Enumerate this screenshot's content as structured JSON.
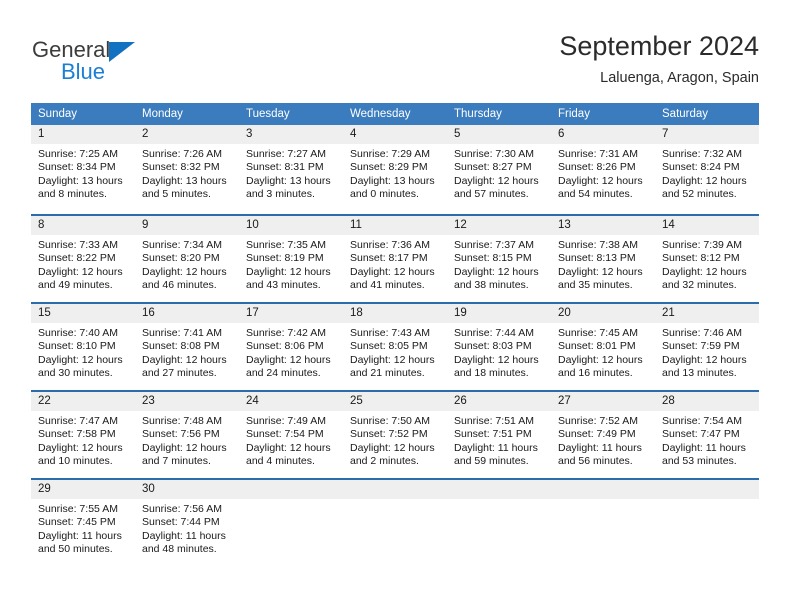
{
  "brand": {
    "name_part1": "General",
    "name_part2": "Blue",
    "accent_color": "#1b7fd4"
  },
  "header": {
    "title": "September 2024",
    "location": "Laluenga, Aragon, Spain"
  },
  "colors": {
    "header_band": "#3a7cbe",
    "row_divider": "#2b6cad",
    "day_number_band": "#efefef"
  },
  "weekdays": [
    "Sunday",
    "Monday",
    "Tuesday",
    "Wednesday",
    "Thursday",
    "Friday",
    "Saturday"
  ],
  "weeks": [
    [
      {
        "day": "1",
        "sunrise": "Sunrise: 7:25 AM",
        "sunset": "Sunset: 8:34 PM",
        "daylight": "Daylight: 13 hours and 8 minutes."
      },
      {
        "day": "2",
        "sunrise": "Sunrise: 7:26 AM",
        "sunset": "Sunset: 8:32 PM",
        "daylight": "Daylight: 13 hours and 5 minutes."
      },
      {
        "day": "3",
        "sunrise": "Sunrise: 7:27 AM",
        "sunset": "Sunset: 8:31 PM",
        "daylight": "Daylight: 13 hours and 3 minutes."
      },
      {
        "day": "4",
        "sunrise": "Sunrise: 7:29 AM",
        "sunset": "Sunset: 8:29 PM",
        "daylight": "Daylight: 13 hours and 0 minutes."
      },
      {
        "day": "5",
        "sunrise": "Sunrise: 7:30 AM",
        "sunset": "Sunset: 8:27 PM",
        "daylight": "Daylight: 12 hours and 57 minutes."
      },
      {
        "day": "6",
        "sunrise": "Sunrise: 7:31 AM",
        "sunset": "Sunset: 8:26 PM",
        "daylight": "Daylight: 12 hours and 54 minutes."
      },
      {
        "day": "7",
        "sunrise": "Sunrise: 7:32 AM",
        "sunset": "Sunset: 8:24 PM",
        "daylight": "Daylight: 12 hours and 52 minutes."
      }
    ],
    [
      {
        "day": "8",
        "sunrise": "Sunrise: 7:33 AM",
        "sunset": "Sunset: 8:22 PM",
        "daylight": "Daylight: 12 hours and 49 minutes."
      },
      {
        "day": "9",
        "sunrise": "Sunrise: 7:34 AM",
        "sunset": "Sunset: 8:20 PM",
        "daylight": "Daylight: 12 hours and 46 minutes."
      },
      {
        "day": "10",
        "sunrise": "Sunrise: 7:35 AM",
        "sunset": "Sunset: 8:19 PM",
        "daylight": "Daylight: 12 hours and 43 minutes."
      },
      {
        "day": "11",
        "sunrise": "Sunrise: 7:36 AM",
        "sunset": "Sunset: 8:17 PM",
        "daylight": "Daylight: 12 hours and 41 minutes."
      },
      {
        "day": "12",
        "sunrise": "Sunrise: 7:37 AM",
        "sunset": "Sunset: 8:15 PM",
        "daylight": "Daylight: 12 hours and 38 minutes."
      },
      {
        "day": "13",
        "sunrise": "Sunrise: 7:38 AM",
        "sunset": "Sunset: 8:13 PM",
        "daylight": "Daylight: 12 hours and 35 minutes."
      },
      {
        "day": "14",
        "sunrise": "Sunrise: 7:39 AM",
        "sunset": "Sunset: 8:12 PM",
        "daylight": "Daylight: 12 hours and 32 minutes."
      }
    ],
    [
      {
        "day": "15",
        "sunrise": "Sunrise: 7:40 AM",
        "sunset": "Sunset: 8:10 PM",
        "daylight": "Daylight: 12 hours and 30 minutes."
      },
      {
        "day": "16",
        "sunrise": "Sunrise: 7:41 AM",
        "sunset": "Sunset: 8:08 PM",
        "daylight": "Daylight: 12 hours and 27 minutes."
      },
      {
        "day": "17",
        "sunrise": "Sunrise: 7:42 AM",
        "sunset": "Sunset: 8:06 PM",
        "daylight": "Daylight: 12 hours and 24 minutes."
      },
      {
        "day": "18",
        "sunrise": "Sunrise: 7:43 AM",
        "sunset": "Sunset: 8:05 PM",
        "daylight": "Daylight: 12 hours and 21 minutes."
      },
      {
        "day": "19",
        "sunrise": "Sunrise: 7:44 AM",
        "sunset": "Sunset: 8:03 PM",
        "daylight": "Daylight: 12 hours and 18 minutes."
      },
      {
        "day": "20",
        "sunrise": "Sunrise: 7:45 AM",
        "sunset": "Sunset: 8:01 PM",
        "daylight": "Daylight: 12 hours and 16 minutes."
      },
      {
        "day": "21",
        "sunrise": "Sunrise: 7:46 AM",
        "sunset": "Sunset: 7:59 PM",
        "daylight": "Daylight: 12 hours and 13 minutes."
      }
    ],
    [
      {
        "day": "22",
        "sunrise": "Sunrise: 7:47 AM",
        "sunset": "Sunset: 7:58 PM",
        "daylight": "Daylight: 12 hours and 10 minutes."
      },
      {
        "day": "23",
        "sunrise": "Sunrise: 7:48 AM",
        "sunset": "Sunset: 7:56 PM",
        "daylight": "Daylight: 12 hours and 7 minutes."
      },
      {
        "day": "24",
        "sunrise": "Sunrise: 7:49 AM",
        "sunset": "Sunset: 7:54 PM",
        "daylight": "Daylight: 12 hours and 4 minutes."
      },
      {
        "day": "25",
        "sunrise": "Sunrise: 7:50 AM",
        "sunset": "Sunset: 7:52 PM",
        "daylight": "Daylight: 12 hours and 2 minutes."
      },
      {
        "day": "26",
        "sunrise": "Sunrise: 7:51 AM",
        "sunset": "Sunset: 7:51 PM",
        "daylight": "Daylight: 11 hours and 59 minutes."
      },
      {
        "day": "27",
        "sunrise": "Sunrise: 7:52 AM",
        "sunset": "Sunset: 7:49 PM",
        "daylight": "Daylight: 11 hours and 56 minutes."
      },
      {
        "day": "28",
        "sunrise": "Sunrise: 7:54 AM",
        "sunset": "Sunset: 7:47 PM",
        "daylight": "Daylight: 11 hours and 53 minutes."
      }
    ],
    [
      {
        "day": "29",
        "sunrise": "Sunrise: 7:55 AM",
        "sunset": "Sunset: 7:45 PM",
        "daylight": "Daylight: 11 hours and 50 minutes."
      },
      {
        "day": "30",
        "sunrise": "Sunrise: 7:56 AM",
        "sunset": "Sunset: 7:44 PM",
        "daylight": "Daylight: 11 hours and 48 minutes."
      },
      {
        "day": "",
        "sunrise": "",
        "sunset": "",
        "daylight": ""
      },
      {
        "day": "",
        "sunrise": "",
        "sunset": "",
        "daylight": ""
      },
      {
        "day": "",
        "sunrise": "",
        "sunset": "",
        "daylight": ""
      },
      {
        "day": "",
        "sunrise": "",
        "sunset": "",
        "daylight": ""
      },
      {
        "day": "",
        "sunrise": "",
        "sunset": "",
        "daylight": ""
      }
    ]
  ]
}
